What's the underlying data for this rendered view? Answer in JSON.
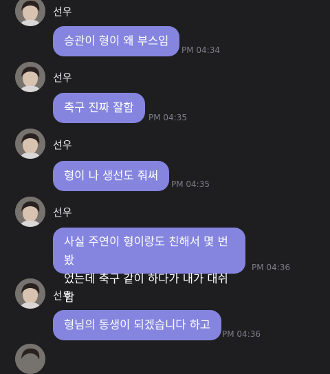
{
  "chat": {
    "messages": [
      {
        "sender": "선우",
        "text": "승관이 형이 왜 부스임",
        "time": "PM 04:34"
      },
      {
        "sender": "선우",
        "text": "축구 진짜 잘함",
        "time": "PM 04:35"
      },
      {
        "sender": "선우",
        "text": "형이 나 생선도 줘써",
        "time": "PM 04:35"
      },
      {
        "sender": "선우",
        "text": "사실 주연이 형이랑도 친해서 몇 번 봤\n었는데 축구 같이 하다가 내가 대쉬함",
        "time": "PM 04:36"
      },
      {
        "sender": "선우",
        "text": "형님의 동생이 되겠습니다 하고",
        "time": "PM 04:36"
      }
    ]
  },
  "colors": {
    "background": "#1e1e21",
    "bubble": "#8585e0",
    "bubble_text": "#ffffff",
    "sender_name": "#e9e9ec",
    "timestamp": "#7d7d86"
  }
}
